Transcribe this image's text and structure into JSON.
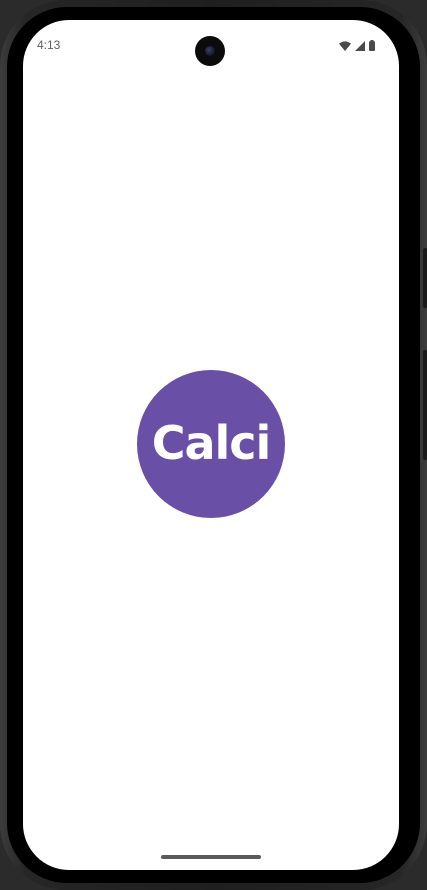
{
  "status_bar": {
    "time": "4:13",
    "icons": [
      "wifi-icon",
      "cellular-signal-icon",
      "battery-icon"
    ]
  },
  "splash": {
    "app_name": "Calci",
    "logo_color": "#6a4fa6"
  },
  "colors": {
    "screen_background": "#ffffff",
    "logo_background": "#6a4fa6",
    "logo_text": "#ffffff"
  }
}
